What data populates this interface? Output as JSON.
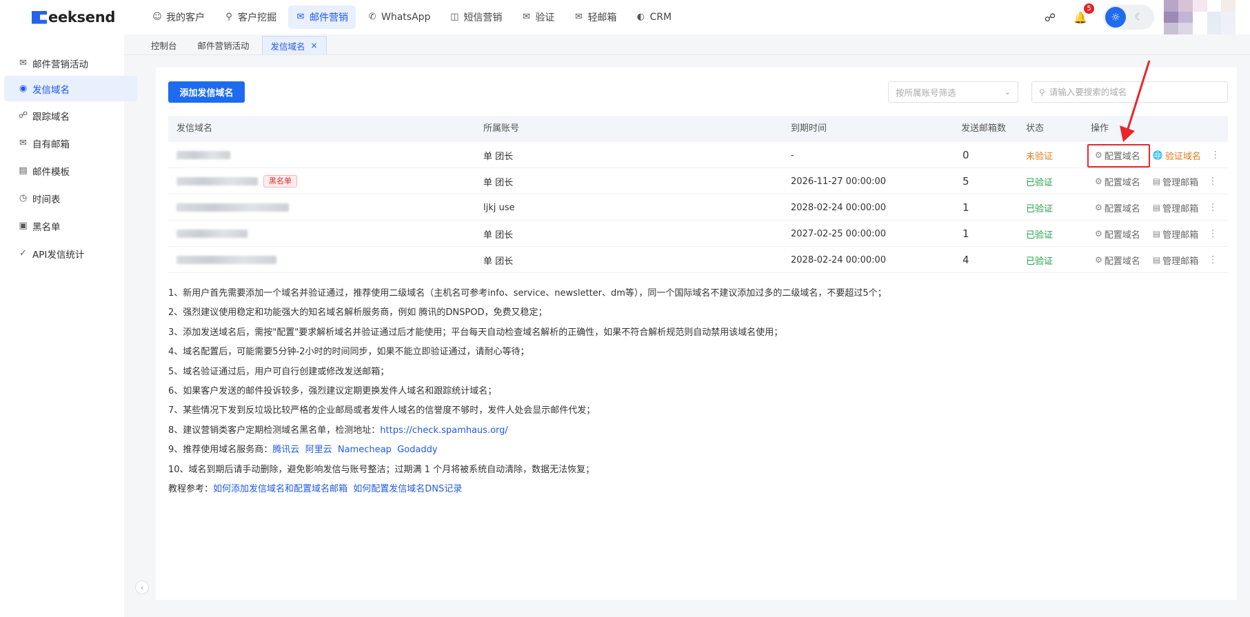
{
  "brand": {
    "name": "eeksend",
    "logo_letter": "G"
  },
  "nav": [
    {
      "label": "我的客户",
      "icon": "user-icon"
    },
    {
      "label": "客户挖掘",
      "icon": "search-icon"
    },
    {
      "label": "邮件营销",
      "icon": "mail-icon",
      "active": true
    },
    {
      "label": "WhatsApp",
      "icon": "whatsapp-icon"
    },
    {
      "label": "短信营销",
      "icon": "sms-icon"
    },
    {
      "label": "验证",
      "icon": "verify-icon"
    },
    {
      "label": "轻邮箱",
      "icon": "light-mail-icon"
    },
    {
      "label": "CRM",
      "icon": "crm-icon"
    }
  ],
  "header": {
    "notification_count": "5"
  },
  "tabs": [
    {
      "label": "控制台"
    },
    {
      "label": "邮件营销活动"
    },
    {
      "label": "发信域名",
      "active": true,
      "close": "×"
    }
  ],
  "sidebar": {
    "items": [
      {
        "label": "邮件营销活动",
        "icon": "campaign-icon"
      },
      {
        "label": "发信域名",
        "icon": "domain-icon",
        "active": true
      },
      {
        "label": "跟踪域名",
        "icon": "track-icon"
      },
      {
        "label": "自有邮箱",
        "icon": "mailbox-icon"
      },
      {
        "label": "邮件模板",
        "icon": "template-icon"
      },
      {
        "label": "时间表",
        "icon": "schedule-icon"
      },
      {
        "label": "黑名单",
        "icon": "blacklist-icon"
      },
      {
        "label": "API发信统计",
        "icon": "api-stats-icon"
      }
    ]
  },
  "toolbar": {
    "add_label": "添加发信域名",
    "filter_placeholder": "按所属账号筛选",
    "search_placeholder": "请输入要搜索的域名"
  },
  "table": {
    "columns": [
      "发信域名",
      "所属账号",
      "到期时间",
      "发送邮箱数",
      "状态",
      "操作"
    ],
    "rows": [
      {
        "account": "单 团长",
        "expire": "-",
        "count": "0",
        "status": "未验证",
        "status_type": "unverified",
        "action1": "配置域名",
        "action2": "验证域名",
        "blacklist": ""
      },
      {
        "account": "单 团长",
        "expire": "2026-11-27 00:00:00",
        "count": "5",
        "status": "已验证",
        "status_type": "verified",
        "action1": "配置域名",
        "action2": "管理邮箱",
        "blacklist": "黑名单"
      },
      {
        "account": "ljkj use",
        "expire": "2028-02-24 00:00:00",
        "count": "1",
        "status": "已验证",
        "status_type": "verified",
        "action1": "配置域名",
        "action2": "管理邮箱",
        "blacklist": ""
      },
      {
        "account": "单 团长",
        "expire": "2027-02-25 00:00:00",
        "count": "1",
        "status": "已验证",
        "status_type": "verified",
        "action1": "配置域名",
        "action2": "管理邮箱",
        "blacklist": ""
      },
      {
        "account": "单 团长",
        "expire": "2028-02-24 00:00:00",
        "count": "4",
        "status": "已验证",
        "status_type": "verified",
        "action1": "配置域名",
        "action2": "管理邮箱",
        "blacklist": ""
      }
    ]
  },
  "notes": {
    "n1": "1、新用户首先需要添加一个域名并验证通过，推荐使用二级域名（主机名可参考info、service、newsletter、dm等），同一个国际域名不建议添加过多的二级域名，不要超过5个；",
    "n2": "2、强烈建议使用稳定和功能强大的知名域名解析服务商，例如 腾讯的DNSPOD，免费又稳定；",
    "n3": "3、添加发送域名后，需按\"配置\"要求解析域名并验证通过后才能使用；平台每天自动检查域名解析的正确性，如果不符合解析规范则自动禁用该域名使用；",
    "n4": "4、域名配置后，可能需要5分钟-2小时的时间同步，如果不能立即验证通过，请耐心等待；",
    "n5": "5、域名验证通过后，用户可自行创建或修改发送邮箱；",
    "n6": "6、如果客户发送的邮件投诉较多，强烈建议定期更换发件人域名和跟踪统计域名；",
    "n7": "7、某些情况下发到反垃圾比较严格的企业邮局或者发件人域名的信誉度不够时，发件人处会显示邮件代发；",
    "n8_prefix": "8、建议营销类客户定期检测域名黑名单，检测地址：",
    "n8_link": "https://check.spamhaus.org/",
    "n9_prefix": "9、推荐使用域名服务商：",
    "n9_links": [
      "腾讯云",
      "阿里云",
      "Namecheap",
      "Godaddy"
    ],
    "n10": "10、域名到期后请手动删除，避免影响发信与账号整洁；过期满 1 个月将被系统自动清除，数据无法恢复；",
    "tutorial_prefix": "教程参考：",
    "tutorial_links": [
      "如何添加发信域名和配置域名邮箱",
      "如何配置发信域名DNS记录"
    ]
  },
  "colors": {
    "primary": "#1f6bf0",
    "verified": "#22a044",
    "unverified": "#e07b1a",
    "highlight": "#e8262b"
  }
}
